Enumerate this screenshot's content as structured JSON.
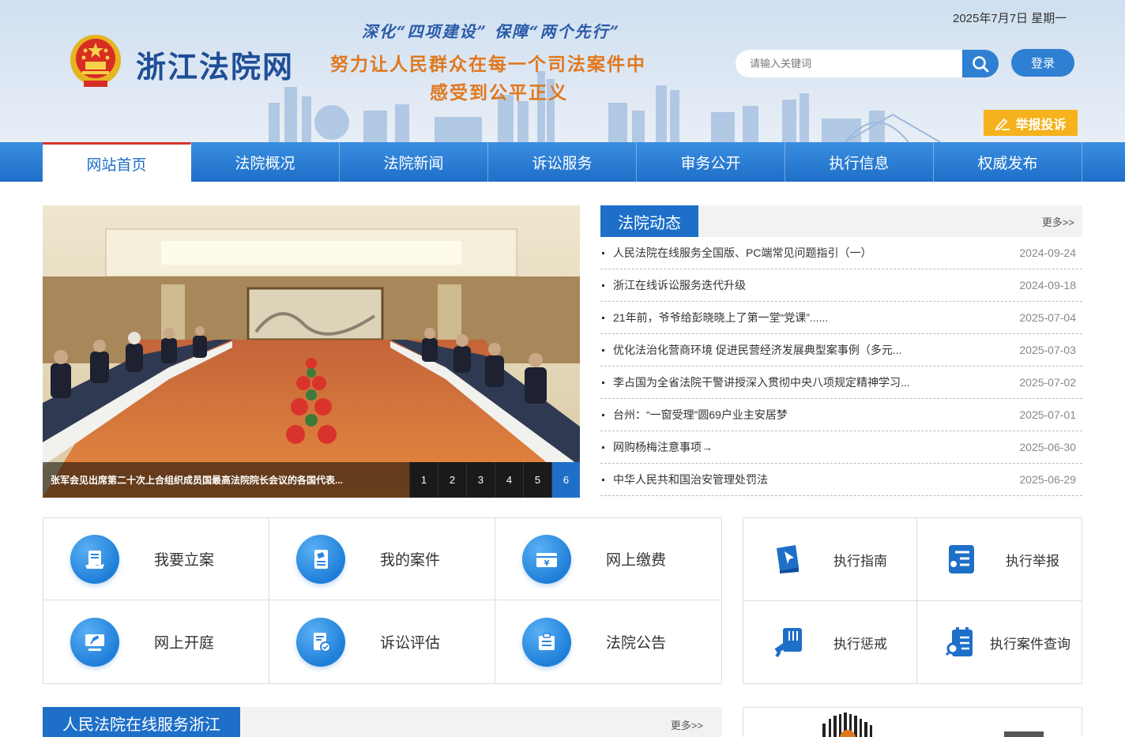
{
  "header": {
    "site_name": "浙江法院网",
    "slogan_line1": "深化“四项建设” 保障“两个先行”",
    "slogan_line2": "努力让人民群众在每一个司法案件中",
    "slogan_line3": "感受到公平正义",
    "date": "2025年7月7日 星期一",
    "search_placeholder": "请输入关键词",
    "login_label": "登录",
    "report_label": "举报投诉"
  },
  "nav": {
    "items": [
      {
        "label": "网站首页"
      },
      {
        "label": "法院概况"
      },
      {
        "label": "法院新闻"
      },
      {
        "label": "诉讼服务"
      },
      {
        "label": "审务公开"
      },
      {
        "label": "执行信息"
      },
      {
        "label": "权威发布"
      }
    ],
    "active_index": 0
  },
  "carousel": {
    "caption": "张军会见出席第二十次上合组织成员国最高法院院长会议的各国代表...",
    "pages": [
      "1",
      "2",
      "3",
      "4",
      "5",
      "6"
    ],
    "active_page": "6"
  },
  "news": {
    "title": "法院动态",
    "more_label": "更多>>",
    "items": [
      {
        "text": "人民法院在线服务全国版、PC端常见问题指引（一）",
        "date": "2024-09-24"
      },
      {
        "text": "浙江在线诉讼服务迭代升级",
        "date": "2024-09-18"
      },
      {
        "text": "21年前，爷爷给彭晓晓上了第一堂“党课”......",
        "date": "2025-07-04"
      },
      {
        "text": "优化法治化营商环境 促进民营经济发展典型案事例（多元...",
        "date": "2025-07-03"
      },
      {
        "text": "李占国为全省法院干警讲授深入贯彻中央八项规定精神学习...",
        "date": "2025-07-02"
      },
      {
        "text": "台州：“一窗受理”圆69户业主安居梦",
        "date": "2025-07-01"
      },
      {
        "text": "网购杨梅注意事项→",
        "date": "2025-06-30"
      },
      {
        "text": "中华人民共和国治安管理处罚法",
        "date": "2025-06-29"
      }
    ]
  },
  "services": [
    {
      "label": "我要立案",
      "icon": "file-hand-icon"
    },
    {
      "label": "我的案件",
      "icon": "case-document-icon"
    },
    {
      "label": "网上缴费",
      "icon": "payment-icon"
    },
    {
      "label": "网上开庭",
      "icon": "gavel-icon"
    },
    {
      "label": "诉讼评估",
      "icon": "assessment-icon"
    },
    {
      "label": "法院公告",
      "icon": "announcement-icon"
    }
  ],
  "execution": [
    {
      "label": "执行指南",
      "icon": "guide-icon"
    },
    {
      "label": "执行举报",
      "icon": "report-icon"
    },
    {
      "label": "执行惩戒",
      "icon": "discipline-icon"
    },
    {
      "label": "执行案件查询",
      "icon": "case-search-icon"
    }
  ],
  "online_service": {
    "title": "人民法院在线服务浙江",
    "more_label": "更多>>"
  },
  "colors": {
    "primary": "#1e6fc8",
    "accent_orange": "#e0781e",
    "report_yellow": "#f5b21c",
    "active_red": "#d9342b"
  }
}
